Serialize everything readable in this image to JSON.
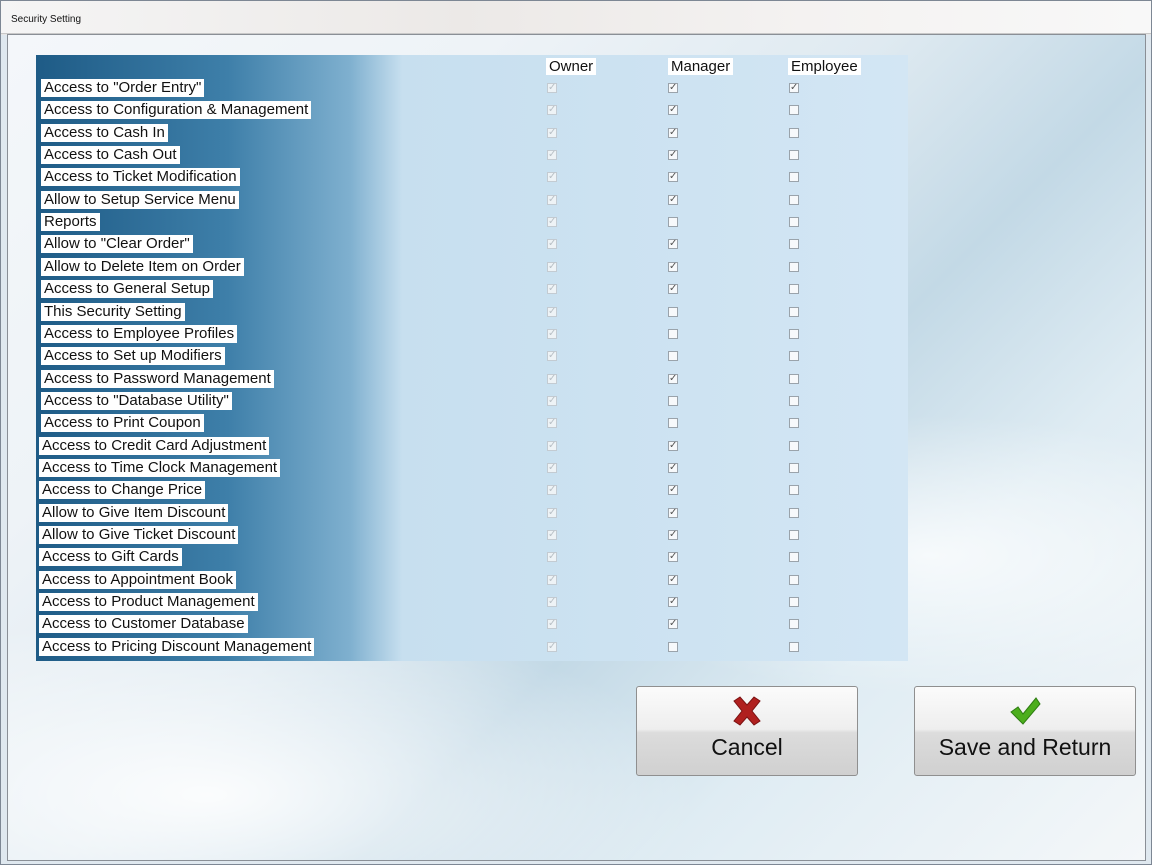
{
  "window": {
    "title": "Security Setting"
  },
  "columns": [
    "Owner",
    "Manager",
    "Employee"
  ],
  "rows": [
    {
      "label": "Access to \"Order Entry\"",
      "owner": true,
      "manager": true,
      "employee": true
    },
    {
      "label": "Access to Configuration & Management",
      "owner": true,
      "manager": true,
      "employee": false
    },
    {
      "label": "Access to Cash In",
      "owner": true,
      "manager": true,
      "employee": false
    },
    {
      "label": "Access to Cash Out",
      "owner": true,
      "manager": true,
      "employee": false
    },
    {
      "label": "Access to Ticket Modification",
      "owner": true,
      "manager": true,
      "employee": false
    },
    {
      "label": "Allow to Setup Service Menu",
      "owner": true,
      "manager": true,
      "employee": false
    },
    {
      "label": "Reports",
      "owner": true,
      "manager": false,
      "employee": false
    },
    {
      "label": "Allow to \"Clear Order\"",
      "owner": true,
      "manager": true,
      "employee": false
    },
    {
      "label": "Allow to Delete Item on Order",
      "owner": true,
      "manager": true,
      "employee": false
    },
    {
      "label": "Access to General Setup",
      "owner": true,
      "manager": true,
      "employee": false
    },
    {
      "label": "This Security Setting",
      "owner": true,
      "manager": false,
      "employee": false
    },
    {
      "label": "Access to Employee Profiles",
      "owner": true,
      "manager": false,
      "employee": false
    },
    {
      "label": "Access to Set up Modifiers",
      "owner": true,
      "manager": false,
      "employee": false
    },
    {
      "label": "Access to Password Management",
      "owner": true,
      "manager": true,
      "employee": false
    },
    {
      "label": "Access to \"Database Utility\"",
      "owner": true,
      "manager": false,
      "employee": false
    },
    {
      "label": "Access to Print Coupon",
      "owner": true,
      "manager": false,
      "employee": false
    },
    {
      "label": "Access to Credit Card Adjustment",
      "owner": true,
      "manager": true,
      "employee": false
    },
    {
      "label": "Access to Time Clock Management",
      "owner": true,
      "manager": true,
      "employee": false
    },
    {
      "label": "Access to Change Price",
      "owner": true,
      "manager": true,
      "employee": false
    },
    {
      "label": "Allow to Give Item Discount",
      "owner": true,
      "manager": true,
      "employee": false
    },
    {
      "label": "Allow to Give Ticket Discount",
      "owner": true,
      "manager": true,
      "employee": false
    },
    {
      "label": "Access to Gift Cards",
      "owner": true,
      "manager": true,
      "employee": false
    },
    {
      "label": "Access to Appointment Book",
      "owner": true,
      "manager": true,
      "employee": false
    },
    {
      "label": "Access to Product Management",
      "owner": true,
      "manager": true,
      "employee": false
    },
    {
      "label": "Access to Customer Database",
      "owner": true,
      "manager": true,
      "employee": false
    },
    {
      "label": "Access to Pricing Discount Management",
      "owner": true,
      "manager": false,
      "employee": false
    }
  ],
  "buttons": {
    "cancel": {
      "label": "Cancel",
      "icon": "red-x-icon"
    },
    "save": {
      "label": "Save and Return",
      "icon": "green-check-icon"
    }
  },
  "colors": {
    "cancel_icon": "#b0201f",
    "save_icon": "#4cae1d"
  }
}
